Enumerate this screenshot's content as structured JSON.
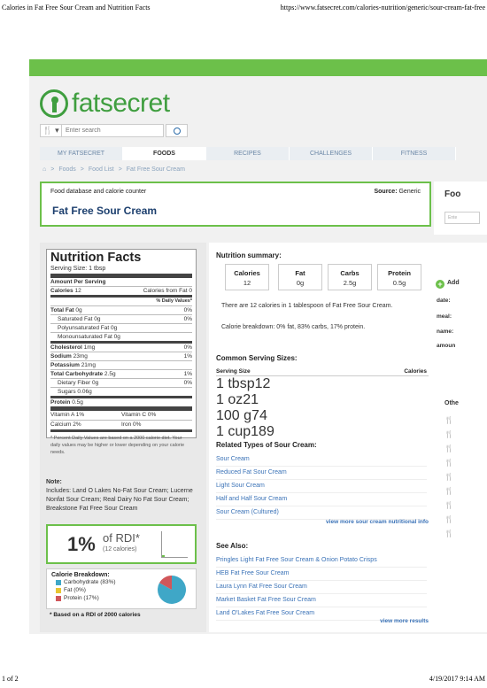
{
  "print_header": {
    "left": "Calories in Fat Free Sour Cream and Nutrition Facts",
    "right": "https://www.fatsecret.com/calories-nutrition/generic/sour-cream-fat-free"
  },
  "print_footer": {
    "left": "1 of 2",
    "right": "4/19/2017 9:14 AM"
  },
  "logo": {
    "text": "fatsecret"
  },
  "search": {
    "placeholder": "Enter search",
    "fork_label": "🍴 ▾"
  },
  "nav": {
    "tabs": [
      "MY FATSECRET",
      "FOODS",
      "RECIPES",
      "CHALLENGES",
      "FITNESS"
    ]
  },
  "breadcrumb": {
    "sep": ">",
    "items": [
      "Foods",
      "Food List",
      "Fat Free Sour Cream"
    ]
  },
  "header": {
    "db_label": "Food database and calorie counter",
    "source_label": "Source:",
    "source_value": "Generic",
    "title": "Fat Free Sour Cream"
  },
  "right_fragment": {
    "title": "Foo",
    "placeholder": "Ente"
  },
  "nutrition": {
    "title": "Nutrition Facts",
    "serving_size": "Serving Size: 1 tbsp",
    "amount_per": "Amount Per Serving",
    "calories_label": "Calories",
    "calories_value": "12",
    "cal_fat_label": "Calories from Fat",
    "cal_fat_value": "0",
    "dv_header": "% Daily Values*",
    "rows": [
      {
        "label": "Total Fat",
        "value": "0g",
        "dv": "0%"
      },
      {
        "label": "Saturated Fat",
        "value": "0g",
        "dv": "0%"
      },
      {
        "label": "Polyunsaturated Fat",
        "value": "0g",
        "dv": ""
      },
      {
        "label": "Monounsaturated Fat",
        "value": "0g",
        "dv": ""
      },
      {
        "label": "Cholesterol",
        "value": "1mg",
        "dv": "0%"
      },
      {
        "label": "Sodium",
        "value": "23mg",
        "dv": "1%"
      },
      {
        "label": "Potassium",
        "value": "21mg",
        "dv": ""
      },
      {
        "label": "Total Carbohydrate",
        "value": "2.5g",
        "dv": "1%"
      },
      {
        "label": "Dietary Fiber",
        "value": "0g",
        "dv": "0%"
      },
      {
        "label": "Sugars",
        "value": "0.06g",
        "dv": ""
      },
      {
        "label": "Protein",
        "value": "0.5g",
        "dv": ""
      }
    ],
    "vitamins": [
      [
        "Vitamin A 1%",
        "Vitamin C 0%"
      ],
      [
        "Calcium 2%",
        "Iron 0%"
      ]
    ],
    "footnote": "* Percent Daily Values are based on a 2000 calorie diet. Your daily values may be higher or lower depending on your calorie needs."
  },
  "note": {
    "heading": "Note:",
    "text": "Includes: Land O Lakes No-Fat Sour Cream; Lucerne Nonfat Sour Cream; Real Dairy No Fat Sour Cream; Breakstone Fat Free Sour Cream"
  },
  "rdi": {
    "pct": "1%",
    "of": "of RDI*",
    "calories": "(12 calories)",
    "level": 0.01
  },
  "calorie_breakdown": {
    "heading": "Calorie Breakdown:",
    "items": [
      {
        "label": "Carbohydrate (83%)",
        "color": "#3fa7c7",
        "pct": 83
      },
      {
        "label": "Fat (0%)",
        "color": "#e8c531",
        "pct": 0
      },
      {
        "label": "Protein (17%)",
        "color": "#d1565a",
        "pct": 17
      }
    ]
  },
  "rdi_note": "* Based on a RDI of 2000 calories",
  "summary": {
    "heading": "Nutrition summary:",
    "boxes": [
      {
        "label": "Calories",
        "value": "12"
      },
      {
        "label": "Fat",
        "value": "0g"
      },
      {
        "label": "Carbs",
        "value": "2.5g"
      },
      {
        "label": "Protein",
        "value": "0.5g"
      }
    ],
    "sentence": "There are 12 calories in 1 tablespoon of Fat Free Sour Cream.",
    "breakdown": "Calorie breakdown: 0% fat, 83% carbs, 17% protein."
  },
  "serving": {
    "heading": "Common Serving Sizes:",
    "col1": "Serving Size",
    "col2": "Calories",
    "rows": [
      {
        "size": "1 tbsp",
        "cal": "12"
      },
      {
        "size": "1 oz",
        "cal": "21"
      },
      {
        "size": "100 g",
        "cal": "74"
      },
      {
        "size": "1 cup",
        "cal": "189"
      }
    ]
  },
  "related": {
    "heading": "Related Types of Sour Cream:",
    "items": [
      "Sour Cream",
      "Reduced Fat Sour Cream",
      "Light Sour Cream",
      "Half and Half Sour Cream",
      "Sour Cream (Cultured)"
    ],
    "more": "view more sour cream nutritional info"
  },
  "see_also": {
    "heading": "See Also:",
    "items": [
      "Pringles Light Fat Free Sour Cream & Onion Potato Crisps",
      "HEB Fat Free Sour Cream",
      "Laura Lynn Fat Free Sour Cream",
      "Market Basket Fat Free Sour Cream",
      "Land O'Lakes Fat Free Sour Cream"
    ],
    "more": "view more results"
  },
  "right_side": {
    "add": "Add",
    "fields": [
      "date:",
      "meal:",
      "name:",
      "amoun"
    ],
    "other": "Othe"
  }
}
